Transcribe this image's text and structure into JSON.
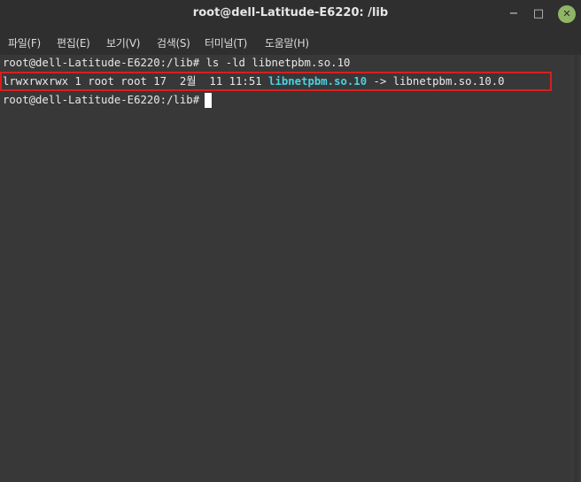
{
  "window": {
    "title": "root@dell-Latitude-E6220: /lib",
    "minimize_icon": "−",
    "maximize_icon": "□",
    "close_icon": "✕"
  },
  "menubar": {
    "items": [
      "파일(F)",
      "편집(E)",
      "보기(V)",
      "검색(S)",
      "터미널(T)",
      "도움말(H)"
    ]
  },
  "terminal": {
    "line1": "root@dell-Latitude-E6220:/lib# ls -ld libnetpbm.so.10",
    "line2_prefix": "lrwxrwxrwx 1 root root 17  2월  11 11:51 ",
    "line2_link": "libnetpbm.so.10",
    "line2_suffix": " -> libnetpbm.so.10.0",
    "line3_prompt": "root@dell-Latitude-E6220:/lib#"
  },
  "colors": {
    "link_color": "#4dd0e1",
    "highlight_box": "#d81e1e",
    "close_button": "#8fb565"
  }
}
